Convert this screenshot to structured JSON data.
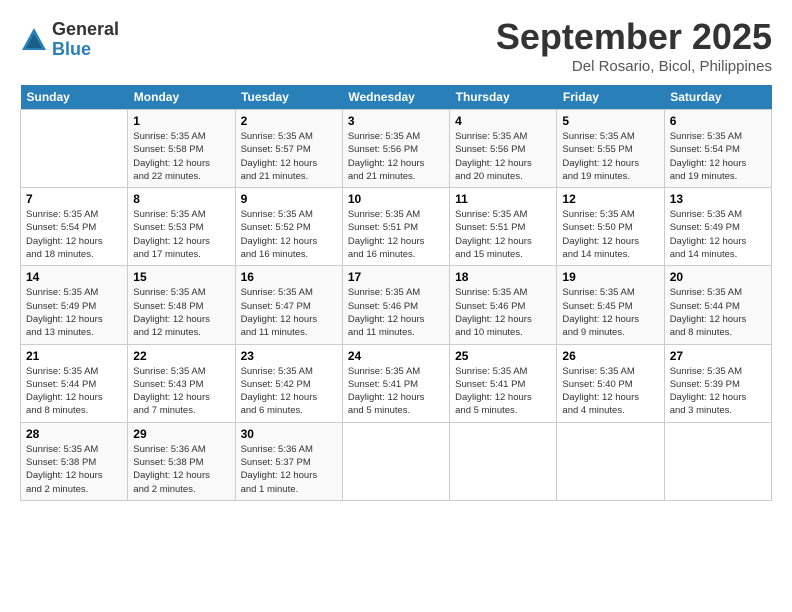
{
  "logo": {
    "general": "General",
    "blue": "Blue"
  },
  "title": "September 2025",
  "subtitle": "Del Rosario, Bicol, Philippines",
  "days_of_week": [
    "Sunday",
    "Monday",
    "Tuesday",
    "Wednesday",
    "Thursday",
    "Friday",
    "Saturday"
  ],
  "weeks": [
    [
      {
        "day": "",
        "info": ""
      },
      {
        "day": "1",
        "info": "Sunrise: 5:35 AM\nSunset: 5:58 PM\nDaylight: 12 hours\nand 22 minutes."
      },
      {
        "day": "2",
        "info": "Sunrise: 5:35 AM\nSunset: 5:57 PM\nDaylight: 12 hours\nand 21 minutes."
      },
      {
        "day": "3",
        "info": "Sunrise: 5:35 AM\nSunset: 5:56 PM\nDaylight: 12 hours\nand 21 minutes."
      },
      {
        "day": "4",
        "info": "Sunrise: 5:35 AM\nSunset: 5:56 PM\nDaylight: 12 hours\nand 20 minutes."
      },
      {
        "day": "5",
        "info": "Sunrise: 5:35 AM\nSunset: 5:55 PM\nDaylight: 12 hours\nand 19 minutes."
      },
      {
        "day": "6",
        "info": "Sunrise: 5:35 AM\nSunset: 5:54 PM\nDaylight: 12 hours\nand 19 minutes."
      }
    ],
    [
      {
        "day": "7",
        "info": "Sunrise: 5:35 AM\nSunset: 5:54 PM\nDaylight: 12 hours\nand 18 minutes."
      },
      {
        "day": "8",
        "info": "Sunrise: 5:35 AM\nSunset: 5:53 PM\nDaylight: 12 hours\nand 17 minutes."
      },
      {
        "day": "9",
        "info": "Sunrise: 5:35 AM\nSunset: 5:52 PM\nDaylight: 12 hours\nand 16 minutes."
      },
      {
        "day": "10",
        "info": "Sunrise: 5:35 AM\nSunset: 5:51 PM\nDaylight: 12 hours\nand 16 minutes."
      },
      {
        "day": "11",
        "info": "Sunrise: 5:35 AM\nSunset: 5:51 PM\nDaylight: 12 hours\nand 15 minutes."
      },
      {
        "day": "12",
        "info": "Sunrise: 5:35 AM\nSunset: 5:50 PM\nDaylight: 12 hours\nand 14 minutes."
      },
      {
        "day": "13",
        "info": "Sunrise: 5:35 AM\nSunset: 5:49 PM\nDaylight: 12 hours\nand 14 minutes."
      }
    ],
    [
      {
        "day": "14",
        "info": "Sunrise: 5:35 AM\nSunset: 5:49 PM\nDaylight: 12 hours\nand 13 minutes."
      },
      {
        "day": "15",
        "info": "Sunrise: 5:35 AM\nSunset: 5:48 PM\nDaylight: 12 hours\nand 12 minutes."
      },
      {
        "day": "16",
        "info": "Sunrise: 5:35 AM\nSunset: 5:47 PM\nDaylight: 12 hours\nand 11 minutes."
      },
      {
        "day": "17",
        "info": "Sunrise: 5:35 AM\nSunset: 5:46 PM\nDaylight: 12 hours\nand 11 minutes."
      },
      {
        "day": "18",
        "info": "Sunrise: 5:35 AM\nSunset: 5:46 PM\nDaylight: 12 hours\nand 10 minutes."
      },
      {
        "day": "19",
        "info": "Sunrise: 5:35 AM\nSunset: 5:45 PM\nDaylight: 12 hours\nand 9 minutes."
      },
      {
        "day": "20",
        "info": "Sunrise: 5:35 AM\nSunset: 5:44 PM\nDaylight: 12 hours\nand 8 minutes."
      }
    ],
    [
      {
        "day": "21",
        "info": "Sunrise: 5:35 AM\nSunset: 5:44 PM\nDaylight: 12 hours\nand 8 minutes."
      },
      {
        "day": "22",
        "info": "Sunrise: 5:35 AM\nSunset: 5:43 PM\nDaylight: 12 hours\nand 7 minutes."
      },
      {
        "day": "23",
        "info": "Sunrise: 5:35 AM\nSunset: 5:42 PM\nDaylight: 12 hours\nand 6 minutes."
      },
      {
        "day": "24",
        "info": "Sunrise: 5:35 AM\nSunset: 5:41 PM\nDaylight: 12 hours\nand 5 minutes."
      },
      {
        "day": "25",
        "info": "Sunrise: 5:35 AM\nSunset: 5:41 PM\nDaylight: 12 hours\nand 5 minutes."
      },
      {
        "day": "26",
        "info": "Sunrise: 5:35 AM\nSunset: 5:40 PM\nDaylight: 12 hours\nand 4 minutes."
      },
      {
        "day": "27",
        "info": "Sunrise: 5:35 AM\nSunset: 5:39 PM\nDaylight: 12 hours\nand 3 minutes."
      }
    ],
    [
      {
        "day": "28",
        "info": "Sunrise: 5:35 AM\nSunset: 5:38 PM\nDaylight: 12 hours\nand 2 minutes."
      },
      {
        "day": "29",
        "info": "Sunrise: 5:36 AM\nSunset: 5:38 PM\nDaylight: 12 hours\nand 2 minutes."
      },
      {
        "day": "30",
        "info": "Sunrise: 5:36 AM\nSunset: 5:37 PM\nDaylight: 12 hours\nand 1 minute."
      },
      {
        "day": "",
        "info": ""
      },
      {
        "day": "",
        "info": ""
      },
      {
        "day": "",
        "info": ""
      },
      {
        "day": "",
        "info": ""
      }
    ]
  ]
}
